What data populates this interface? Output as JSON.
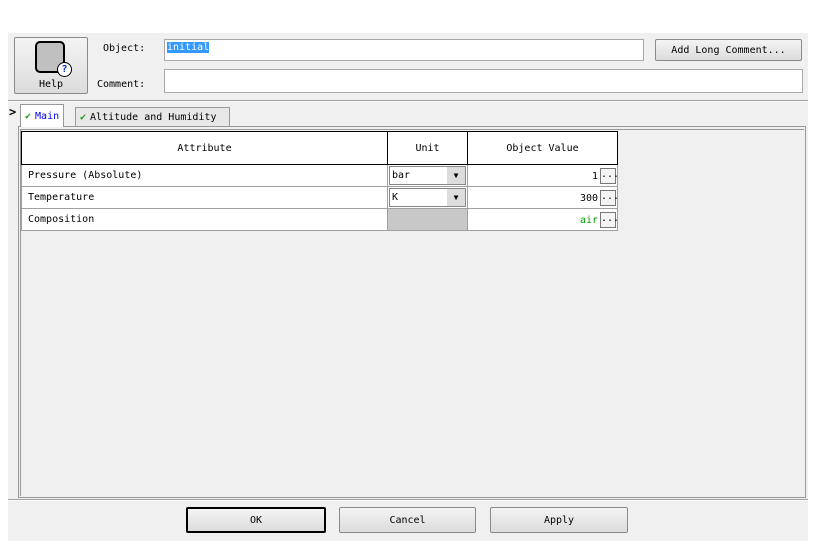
{
  "header": {
    "help_label": "Help",
    "object_label": "Object:",
    "object_value": "initial",
    "comment_label": "Comment:",
    "comment_value": "",
    "add_long_comment": "Add Long Comment..."
  },
  "tabs": [
    {
      "label": "Main",
      "active": true
    },
    {
      "label": "Altitude and Humidity",
      "active": false
    }
  ],
  "table": {
    "headers": [
      "Attribute",
      "Unit",
      "Object Value"
    ],
    "rows": [
      {
        "attribute": "Pressure (Absolute)",
        "unit": "bar",
        "value": "1"
      },
      {
        "attribute": "Temperature",
        "unit": "K",
        "value": "300"
      },
      {
        "attribute": "Composition",
        "unit": "",
        "value": "air"
      }
    ]
  },
  "ellipsis": "...",
  "footer": {
    "ok": "OK",
    "cancel": "Cancel",
    "apply": "Apply"
  },
  "colors": {
    "selection": "#3399ff",
    "air_value": "#00a000",
    "tab_active_text": "#0000ff"
  }
}
